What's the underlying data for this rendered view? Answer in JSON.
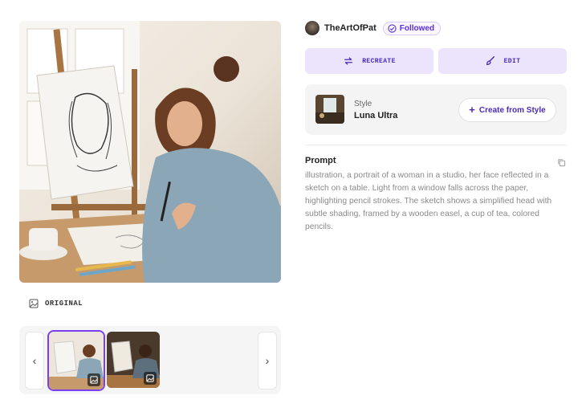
{
  "author": {
    "name": "TheArtOfPat",
    "follow_label": "Followed"
  },
  "actions": {
    "recreate": "RECREATE",
    "edit": "EDIT"
  },
  "style": {
    "caption": "Style",
    "name": "Luna Ultra",
    "create_label": "Create from Style"
  },
  "prompt": {
    "title": "Prompt",
    "text": "illustration, a portrait of a woman in a studio, her face reflected in a sketch on a table. Light from a window falls across the paper, highlighting pencil strokes. The sketch shows a simplified head with subtle shading, framed by a wooden easel, a cup of tea, colored pencils."
  },
  "image": {
    "original_label": "ORIGINAL"
  },
  "thumbnails": [
    {
      "name": "thumb-1",
      "selected": true,
      "icon": "image-icon"
    },
    {
      "name": "thumb-2",
      "selected": false,
      "icon": "image-icon"
    }
  ],
  "colors": {
    "accent": "#7b3ff2",
    "accent_bg": "#ece3fd",
    "accent_text": "#4a2ab8"
  },
  "icons": {
    "followed": "check-circle-icon",
    "recreate": "repeat-icon",
    "edit": "brush-icon",
    "create": "plus-icon",
    "copy": "copy-icon",
    "original": "image-icon",
    "prev": "chevron-left-icon",
    "next": "chevron-right-icon"
  }
}
